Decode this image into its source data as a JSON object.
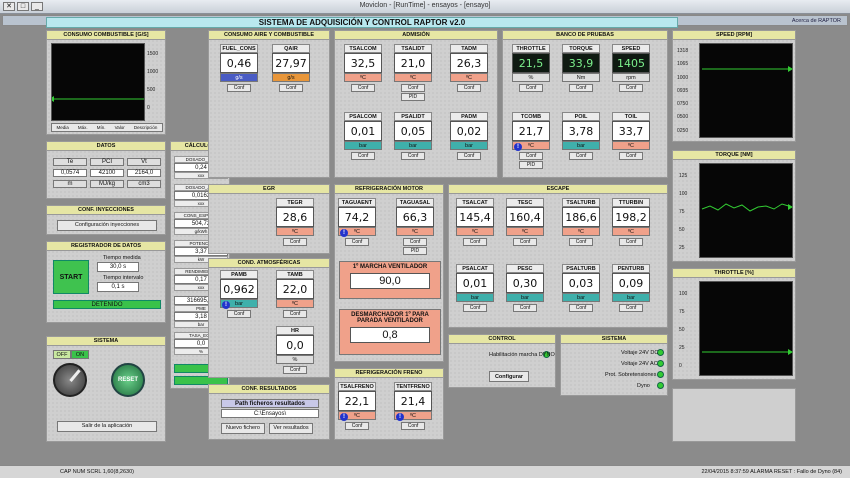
{
  "window": {
    "title": "Moviclon - [RunTime] - ensayos - [ensayo]",
    "btn_min": "_",
    "btn_max": "□",
    "btn_close": "✕"
  },
  "app": {
    "about": "Acerca de RAPTOR",
    "title": "SISTEMA DE ADQUISICIÓN Y CONTROL RAPTOR v2.0"
  },
  "graphs": {
    "speed": {
      "title": "SPEED [RPM]",
      "ticks": [
        "1318",
        "1065",
        "1000",
        "0935",
        "0750",
        "0500",
        "0250"
      ]
    },
    "torque": {
      "title": "TORQUE [Nm]",
      "ticks": [
        "125",
        "100",
        "75",
        "50",
        "25"
      ]
    },
    "throttle": {
      "title": "THROTTLE [%]",
      "ticks": [
        "100",
        "75",
        "50",
        "25",
        "0"
      ]
    },
    "consumo": {
      "title": "CONSUMO COMBUSTIBLE [g/s]",
      "ticks": [
        "1500",
        "1000",
        "500",
        "0"
      ],
      "cols": [
        "Descripción",
        "Valor",
        "Mín.",
        "Máx.",
        "Media"
      ]
    }
  },
  "aire": {
    "title": "CONSUMO AIRE Y COMBUSTIBLE",
    "fuel_cons": {
      "cap": "FUEL_CONS",
      "val": "0,46",
      "unit": "g/s"
    },
    "qair": {
      "cap": "QAIR",
      "val": "27,97",
      "unit": "g/s"
    }
  },
  "admision": {
    "title": "ADMISIÓN",
    "row1": [
      {
        "cap": "TADM",
        "val": "26,3",
        "unit": "ºC"
      },
      {
        "cap": "TSALIDT",
        "val": "21,0",
        "unit": "ºC"
      },
      {
        "cap": "TSALCOM",
        "val": "32,5",
        "unit": "ºC"
      }
    ],
    "row2": [
      {
        "cap": "PADM",
        "val": "0,02",
        "unit": "bar",
        "sub": "0,00"
      },
      {
        "cap": "PSALIDT",
        "val": "0,05",
        "unit": "bar"
      },
      {
        "cap": "PSALCOM",
        "val": "0,01",
        "unit": "bar"
      }
    ],
    "pid": "PID"
  },
  "banco": {
    "title": "BANCO DE PRUEBAS",
    "row1": [
      {
        "cap": "SPEED",
        "val": "1405",
        "unit": "rpm"
      },
      {
        "cap": "TORQUE",
        "val": "33,9",
        "unit": "Nm"
      },
      {
        "cap": "THROTTLE",
        "val": "21,5",
        "unit": "%"
      }
    ],
    "row2": [
      {
        "cap": "TOIL",
        "val": "33,7",
        "unit": "ºC"
      },
      {
        "cap": "POIL",
        "val": "3,78",
        "unit": "bar",
        "sub": "3,78"
      },
      {
        "cap": "TCOMB",
        "val": "21,7",
        "unit": "ºC"
      }
    ],
    "pid": "PID"
  },
  "egr": {
    "title": "EGR",
    "tegr": {
      "cap": "TEGR",
      "val": "28,6",
      "unit": "ºC"
    }
  },
  "refmotor": {
    "title": "REFRIGERACIÓN MOTOR",
    "cards": [
      {
        "cap": "TAGUASAL",
        "val": "66,3",
        "unit": "ºC"
      },
      {
        "cap": "TAGUAENT",
        "val": "74,2",
        "unit": "ºC"
      }
    ],
    "pid": "PID",
    "marcha": {
      "label": "1º MARCHA VENTILADOR",
      "val": "90,0"
    },
    "parada": {
      "label": "DESMARCHADOR 1º PARA PARADA VENTILADOR",
      "val": "0,8"
    }
  },
  "atmos": {
    "title": "COND. ATMOSFÉRICAS",
    "tamb": {
      "cap": "TAMB",
      "val": "22,0",
      "unit": "ºC"
    },
    "pamb": {
      "cap": "PAMB",
      "val": "0,962",
      "unit": "bar"
    },
    "hr": {
      "cap": "HR",
      "val": "0,0",
      "unit": "%"
    }
  },
  "escape": {
    "title": "ESCAPE",
    "row1": [
      {
        "cap": "TTURBIN",
        "val": "198,2",
        "unit": "ºC"
      },
      {
        "cap": "TSALTURB",
        "val": "186,6",
        "unit": "ºC"
      },
      {
        "cap": "TESC",
        "val": "160,4",
        "unit": "ºC"
      },
      {
        "cap": "TSALCAT",
        "val": "145,4",
        "unit": "ºC"
      }
    ],
    "row2": [
      {
        "cap": "PENTURB",
        "val": "0,09",
        "unit": "bar"
      },
      {
        "cap": "PSALTURB",
        "val": "0,03",
        "unit": "bar"
      },
      {
        "cap": "PESC",
        "val": "0,30",
        "unit": "bar",
        "sub": "0,30"
      },
      {
        "cap": "PSALCAT",
        "val": "0,01",
        "unit": "bar"
      }
    ]
  },
  "calculos": {
    "title": "CÁLCULOS",
    "rows": [
      {
        "n": "DOSADO_REL",
        "v": "0,24"
      },
      {
        "n": "DOSADO_ABS",
        "v": "0,0162"
      },
      {
        "n": "CONS_ESPECIF",
        "v": "504,72"
      },
      {
        "n": "POTENCIA",
        "v": "3,37"
      },
      {
        "n": "RENDIMIENTO",
        "v": "0,17"
      },
      {
        "n": "PME",
        "v": "3,18"
      },
      {
        "n": "TASA_EGR",
        "v": "0,0"
      }
    ],
    "units": [
      "xxx",
      "xxx",
      "g/kWh",
      "kW",
      "xxx",
      "bar",
      "%"
    ],
    "extra": "316695,95"
  },
  "datos": {
    "title": "DATOS",
    "h1": [
      "Te",
      "PCI",
      "Vt"
    ],
    "v1": [
      "0,0574",
      "42100",
      "2164,0"
    ],
    "u1": [
      "m",
      "MJ/kg",
      "cm3"
    ]
  },
  "inyecc": {
    "title": "CONF. INYECCIONES",
    "btn": "Configuración inyecciones"
  },
  "registro": {
    "title": "REGISTRADOR DE DATOS",
    "tmedida_lbl": "Tiempo medida",
    "tmedida": "30,0 s",
    "tint_lbl": "Tiempo intervalo",
    "tint": "0,1 s",
    "start": "START",
    "state": "DETENIDO"
  },
  "control": {
    "title": "CONTROL",
    "lbl": "Habilitación marcha DYNO",
    "btn": "Configurar"
  },
  "sistema": {
    "title": "SISTEMA",
    "items": [
      "Voltaje 24V DC",
      "Voltaje 24V AC",
      "Prot. Sobretensiones",
      "Dyno"
    ]
  },
  "sistema2": {
    "title": "SISTEMA",
    "off": "OFF",
    "on": "ON",
    "reset": "RESET",
    "salir": "Salir de la aplicación"
  },
  "refreno": {
    "title": "REFRIGERACIÓN FRENO",
    "cards": [
      {
        "cap": "TENTFRENO",
        "val": "21,4",
        "unit": "ºC"
      },
      {
        "cap": "TSALFRENO",
        "val": "22,1",
        "unit": "ºC"
      }
    ]
  },
  "resultados": {
    "title": "CONF. RESULTADOS",
    "path_lbl": "Path ficheros resultados",
    "path": "C:\\Ensayos\\",
    "nuevo": "Nuevo fichero",
    "ver": "Ver resultados"
  },
  "conf": "Conf",
  "status": {
    "left": "22/04/2015 8:37:59  ALARMA RESET : Fallo de Dyno (84)",
    "right": "CAP NUM SCRL 1,60(8,2630)"
  }
}
